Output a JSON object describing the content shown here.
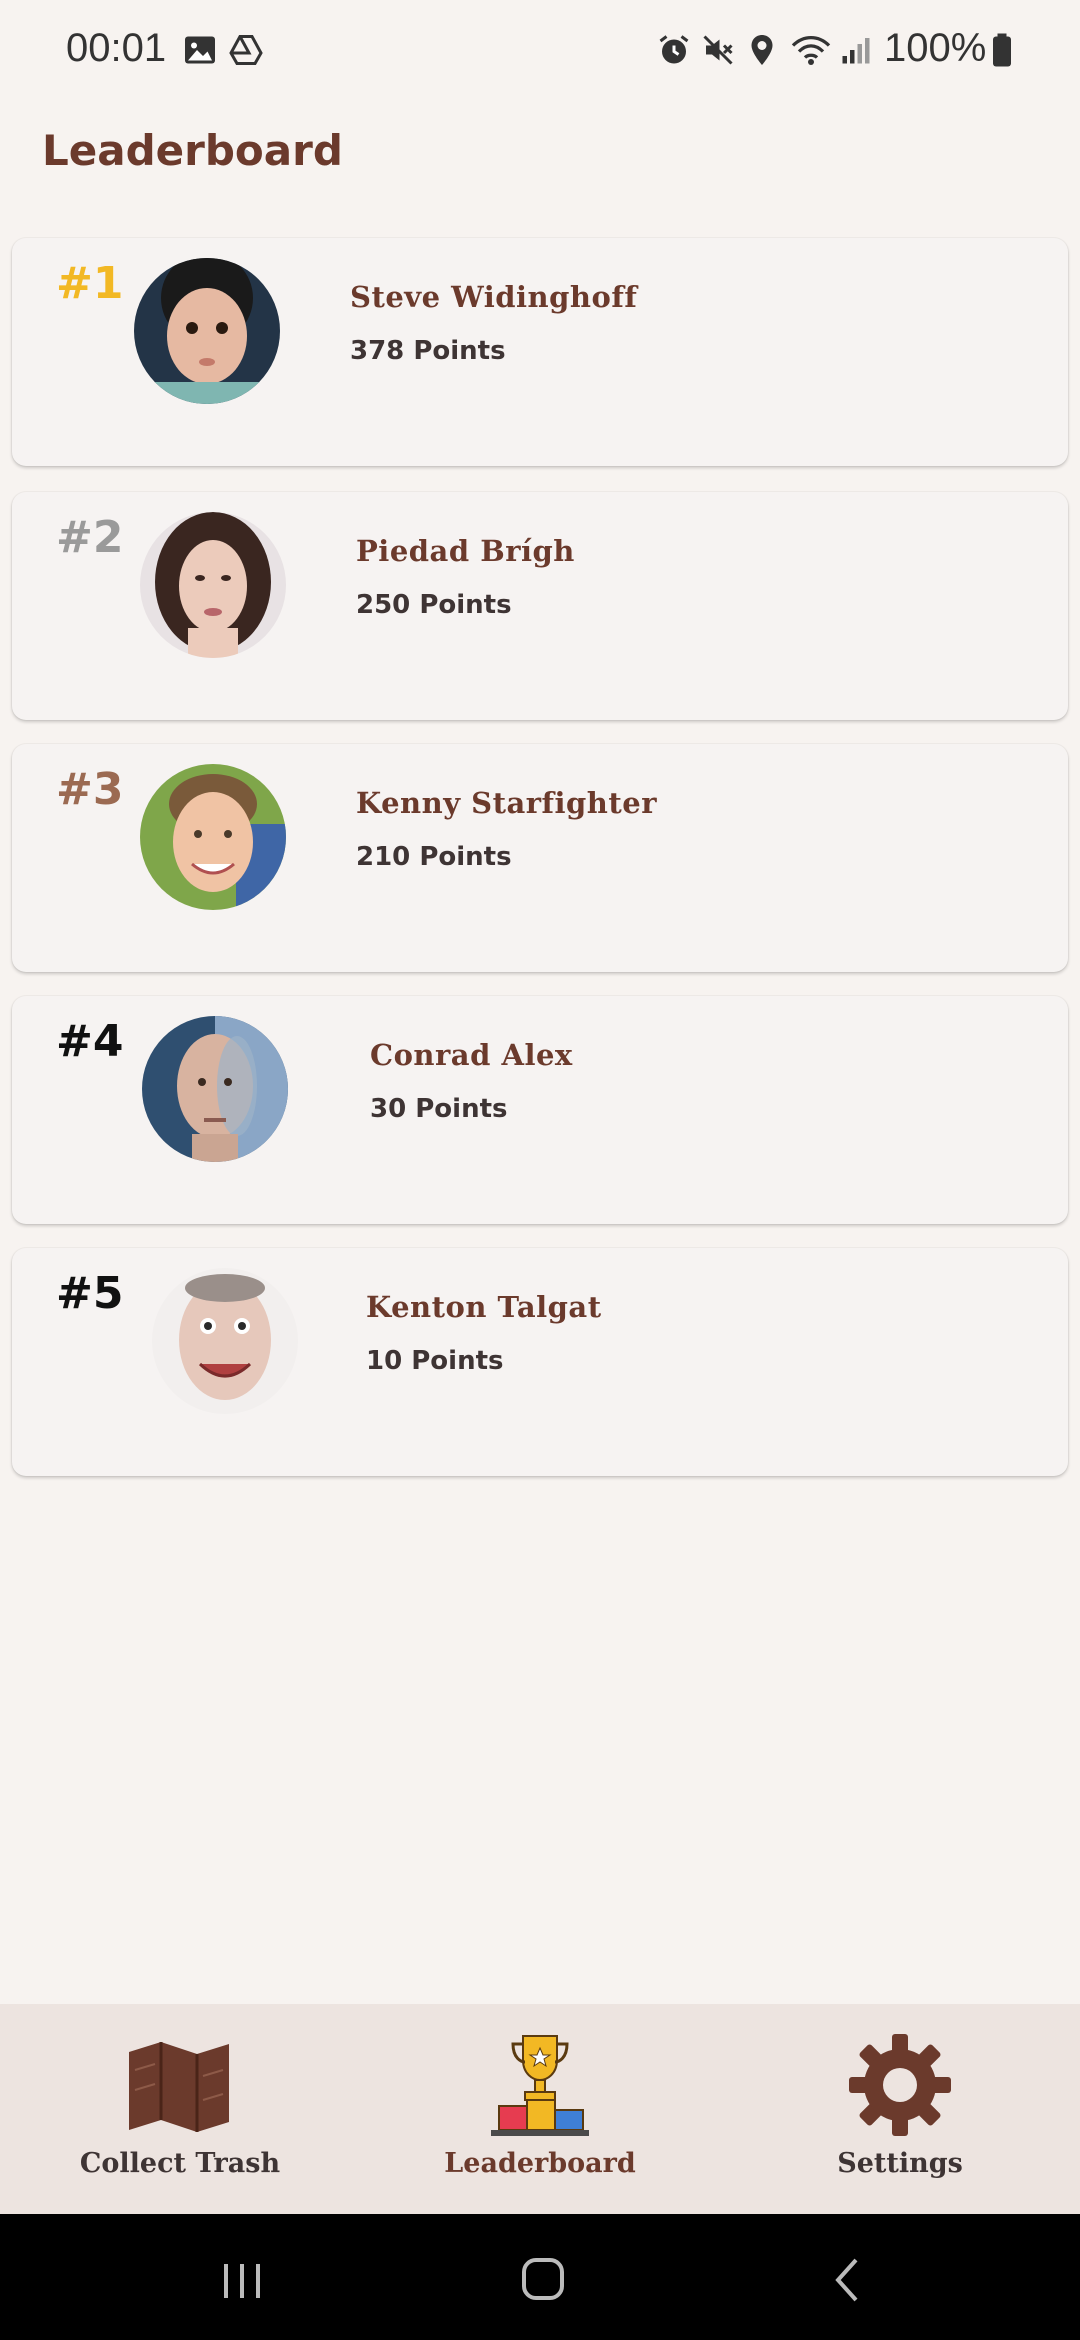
{
  "status_bar": {
    "time": "00:01",
    "battery": "100%",
    "icons": [
      "image-icon",
      "drive-icon",
      "alarm-icon",
      "mute-icon",
      "location-icon",
      "wifi-icon",
      "signal-icon",
      "battery-icon"
    ]
  },
  "page": {
    "title": "Leaderboard"
  },
  "leaderboard": [
    {
      "rank": "#1",
      "name": "Steve Widinghoff",
      "points": "378 Points",
      "rank_color": "#f2b824"
    },
    {
      "rank": "#2",
      "name": "Piedad Brígh",
      "points": "250 Points",
      "rank_color": "#9a9a9a"
    },
    {
      "rank": "#3",
      "name": "Kenny Starfighter",
      "points": "210 Points",
      "rank_color": "#9b6a52"
    },
    {
      "rank": "#4",
      "name": "Conrad Alex",
      "points": "30 Points",
      "rank_color": "#111111"
    },
    {
      "rank": "#5",
      "name": "Kenton Talgat",
      "points": "10 Points",
      "rank_color": "#111111"
    }
  ],
  "nav": {
    "collect": "Collect Trash",
    "leaderboard": "Leaderboard",
    "settings": "Settings"
  },
  "colors": {
    "accent": "#6b3a2c",
    "nav_active": "#6b3a2c",
    "nav_inactive": "#3e3434"
  }
}
